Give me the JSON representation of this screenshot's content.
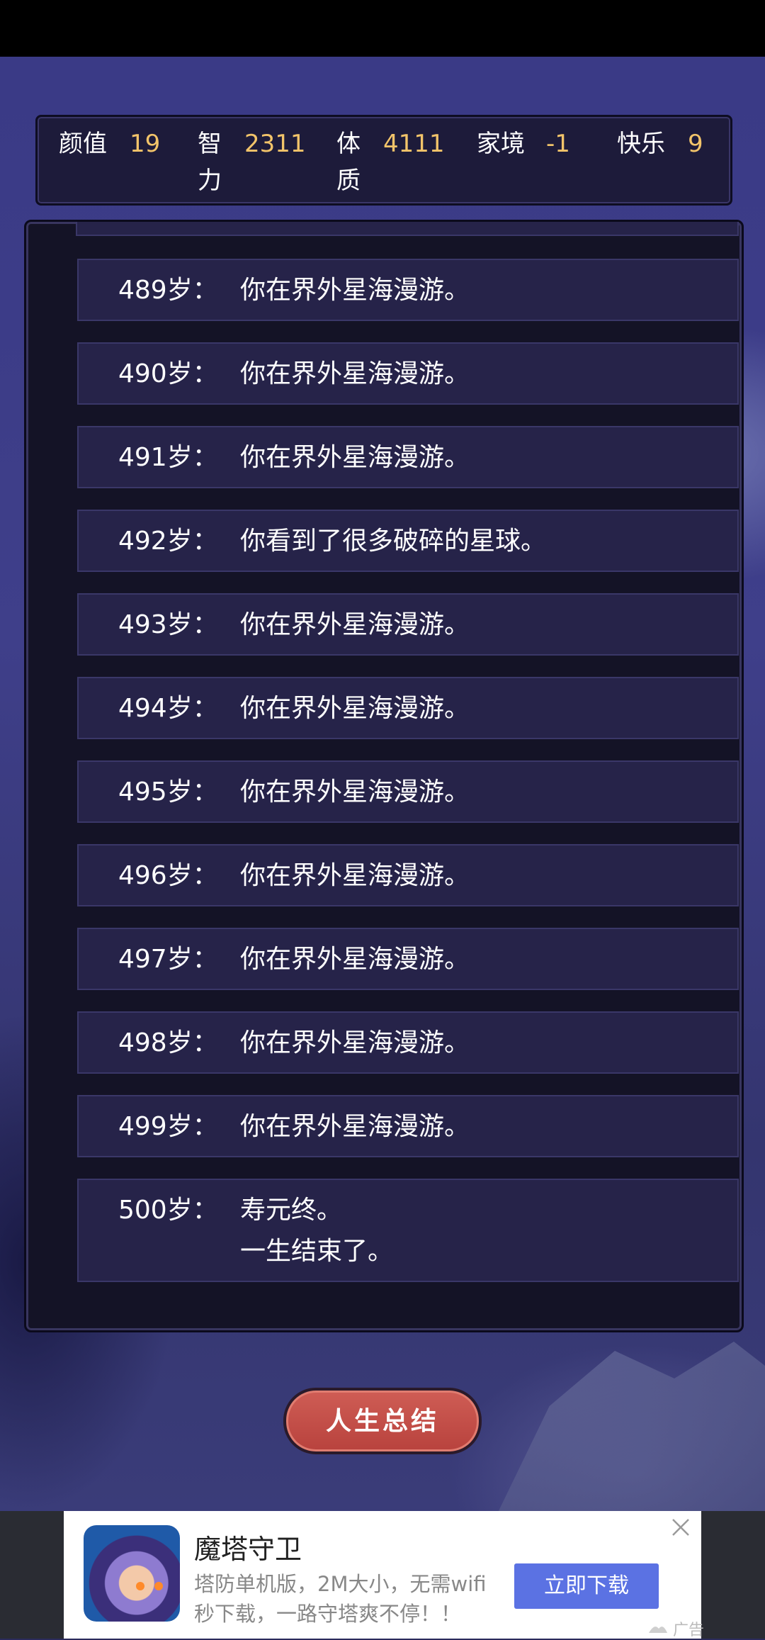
{
  "stats": [
    {
      "label": "颜值",
      "value": "19"
    },
    {
      "label": "智力",
      "value": "2311"
    },
    {
      "label": "体质",
      "value": "4111"
    },
    {
      "label": "家境",
      "value": "-1"
    },
    {
      "label": "快乐",
      "value": "9"
    }
  ],
  "log": [
    {
      "age": "489岁：",
      "text": "你在界外星海漫游。"
    },
    {
      "age": "490岁：",
      "text": "你在界外星海漫游。"
    },
    {
      "age": "491岁：",
      "text": "你在界外星海漫游。"
    },
    {
      "age": "492岁：",
      "text": "你看到了很多破碎的星球。"
    },
    {
      "age": "493岁：",
      "text": "你在界外星海漫游。"
    },
    {
      "age": "494岁：",
      "text": "你在界外星海漫游。"
    },
    {
      "age": "495岁：",
      "text": "你在界外星海漫游。"
    },
    {
      "age": "496岁：",
      "text": "你在界外星海漫游。"
    },
    {
      "age": "497岁：",
      "text": "你在界外星海漫游。"
    },
    {
      "age": "498岁：",
      "text": "你在界外星海漫游。"
    },
    {
      "age": "499岁：",
      "text": "你在界外星海漫游。"
    },
    {
      "age": "500岁：",
      "text": "寿元终。",
      "text2": "一生结束了。"
    }
  ],
  "summary_button": "人生总结",
  "ad": {
    "title": "魔塔守卫",
    "description": "塔防单机版，2M大小，无需wifi\n秒下载，一路守塔爽不停！！",
    "download_label": "立即下载",
    "tag": "广告"
  },
  "colors": {
    "stat_value": "#f2c46a",
    "button": "#c24b45",
    "ad_button": "#5b72e3"
  }
}
